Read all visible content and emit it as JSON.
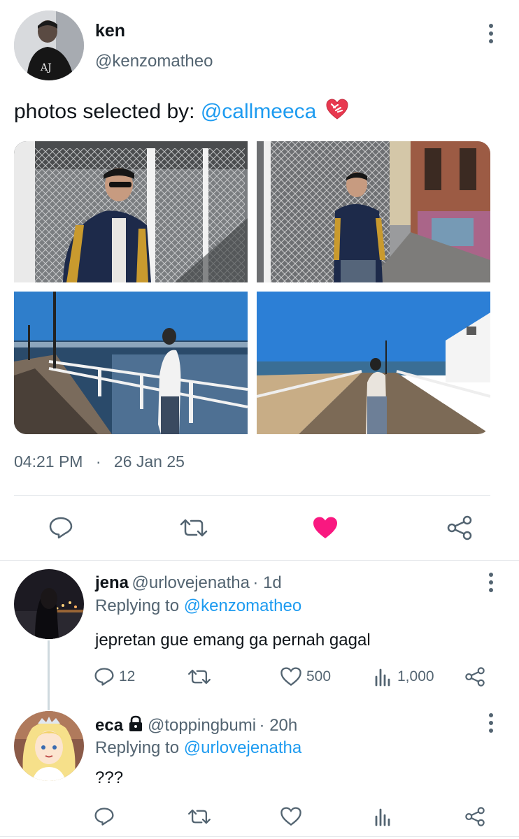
{
  "tweet": {
    "author": {
      "name": "ken",
      "handle": "@kenzomatheo"
    },
    "text_prefix": "photos selected by: ",
    "mention": "@callmeeca",
    "emoji": "❤️‍🩹",
    "time": "04:21 PM",
    "separator": "·",
    "date": "26 Jan 25",
    "liked": true
  },
  "photos": [
    {
      "alt": "man in jacket by chain-link fence"
    },
    {
      "alt": "man in jacket walking down graffiti lane"
    },
    {
      "alt": "man on wooden pier by the sea"
    },
    {
      "alt": "man walking on pier toward camera"
    }
  ],
  "replies": [
    {
      "name": "jena",
      "handle": "@urlovejenatha",
      "age": "· 1d",
      "replying_label": "Replying to ",
      "replying_to": "@kenzomatheo",
      "text": "jepretan gue emang ga pernah gagal",
      "reply_count": "12",
      "like_count": "500",
      "view_count": "1,000"
    },
    {
      "name": "eca",
      "handle": "@toppingbumi",
      "age": "· 20h",
      "replying_label": "Replying to ",
      "replying_to": "@urlovejenatha",
      "text": "???",
      "locked": true
    }
  ],
  "colors": {
    "accent": "#1d9bf0",
    "like": "#f91880",
    "muted": "#536471"
  },
  "icons": [
    "more-icon",
    "reply-icon",
    "retweet-icon",
    "heart-icon",
    "share-icon",
    "views-icon",
    "lock-icon"
  ]
}
